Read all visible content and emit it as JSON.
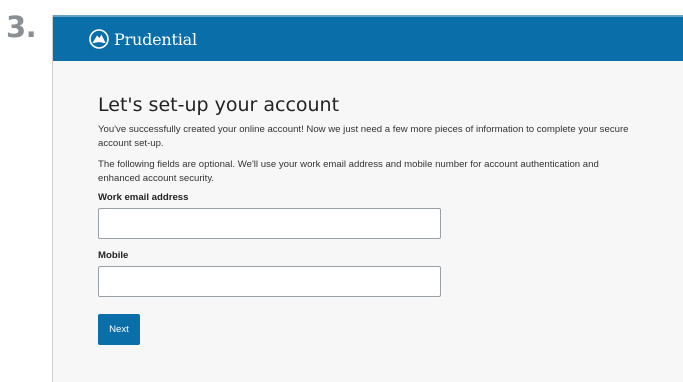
{
  "step": {
    "number": "3."
  },
  "header": {
    "brand": "Prudential",
    "logo_icon": "rock-logo-icon",
    "color": "#0a6ea9"
  },
  "main": {
    "title": "Let's set-up your account",
    "intro": "You've successfully created your online account! Now we just need a few more pieces of information to complete your secure account set-up.",
    "optional_note": "The following fields are optional. We'll use your work email address and mobile number for account authentication and enhanced account security.",
    "fields": {
      "work_email": {
        "label": "Work email address",
        "value": "",
        "placeholder": ""
      },
      "mobile": {
        "label": "Mobile",
        "value": "",
        "placeholder": ""
      }
    },
    "next_label": "Next"
  }
}
